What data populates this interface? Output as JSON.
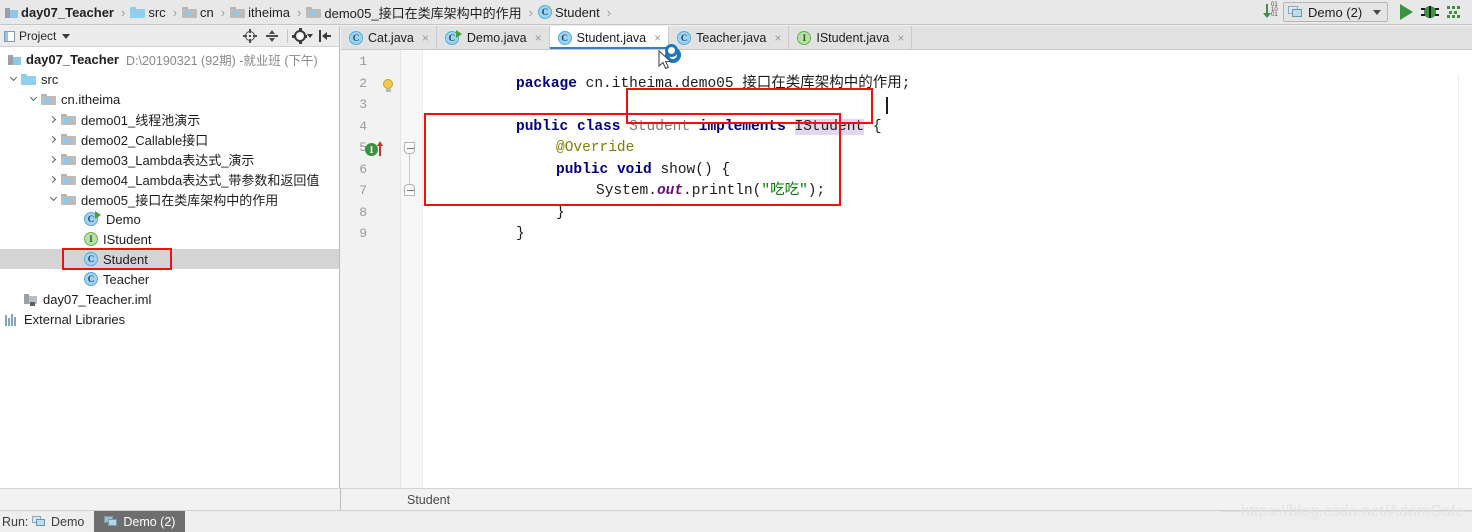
{
  "window": {
    "ide": "IntelliJ IDEA",
    "watermark": "https://blog.csdn.net/AdamCafe"
  },
  "navbar": {
    "crumbs": [
      {
        "label": "day07_Teacher",
        "icon": "module-icon",
        "bold": true
      },
      {
        "label": "src",
        "icon": "source-folder-icon",
        "bold": false
      },
      {
        "label": "cn",
        "icon": "package-icon",
        "bold": false
      },
      {
        "label": "itheima",
        "icon": "package-icon",
        "bold": false
      },
      {
        "label": "demo05_接口在类库架构中的作用",
        "icon": "package-icon",
        "bold": false
      },
      {
        "label": "Student",
        "icon": "class-icon",
        "bold": false
      }
    ],
    "separator": "›",
    "sort_icon": "sort-numeric-icon",
    "sort_digits": [
      "01",
      "10",
      "01"
    ],
    "run_config": {
      "name": "Demo (2)",
      "icon": "run-configuration-icon",
      "chevron": "chevron-down-icon"
    },
    "run_button": "run-icon",
    "debug_button": "debug-icon",
    "coverage_button": "coverage-icon"
  },
  "project_panel": {
    "title": "Project",
    "actions": [
      "locate-icon",
      "collapse-all-icon",
      "settings-gear-icon",
      "hide-icon"
    ],
    "tree": [
      {
        "id": "root",
        "label": "day07_Teacher",
        "path": "D:\\20190321 (92期) -就业班 (下午)",
        "icon": "module-icon",
        "indent": 0,
        "arrow": "none",
        "bold": true,
        "selected": false
      },
      {
        "id": "src",
        "label": "src",
        "path": "",
        "icon": "source-folder-icon",
        "indent": 1,
        "arrow": "down",
        "bold": false,
        "selected": false
      },
      {
        "id": "cn-itheima",
        "label": "cn.itheima",
        "path": "",
        "icon": "package-icon",
        "indent": 2,
        "arrow": "down",
        "bold": false,
        "selected": false
      },
      {
        "id": "demo01",
        "label": "demo01_线程池演示",
        "path": "",
        "icon": "package-icon",
        "indent": 3,
        "arrow": "right",
        "bold": false,
        "selected": false
      },
      {
        "id": "demo02",
        "label": "demo02_Callable接口",
        "path": "",
        "icon": "package-icon",
        "indent": 3,
        "arrow": "right",
        "bold": false,
        "selected": false
      },
      {
        "id": "demo03",
        "label": "demo03_Lambda表达式_演示",
        "path": "",
        "icon": "package-icon",
        "indent": 3,
        "arrow": "right",
        "bold": false,
        "selected": false
      },
      {
        "id": "demo04",
        "label": "demo04_Lambda表达式_带参数和返回值",
        "path": "",
        "icon": "package-icon",
        "indent": 3,
        "arrow": "right",
        "bold": false,
        "selected": false
      },
      {
        "id": "demo05",
        "label": "demo05_接口在类库架构中的作用",
        "path": "",
        "icon": "package-icon",
        "indent": 3,
        "arrow": "down",
        "bold": false,
        "selected": false
      },
      {
        "id": "demo-class",
        "label": "Demo",
        "path": "",
        "icon": "runnable-class-icon",
        "indent": 4,
        "arrow": "none",
        "bold": false,
        "selected": false
      },
      {
        "id": "istudent",
        "label": "IStudent",
        "path": "",
        "icon": "interface-icon",
        "indent": 4,
        "arrow": "none",
        "bold": false,
        "selected": false
      },
      {
        "id": "student",
        "label": "Student",
        "path": "",
        "icon": "class-icon",
        "indent": 4,
        "arrow": "none",
        "bold": false,
        "selected": true
      },
      {
        "id": "teacher",
        "label": "Teacher",
        "path": "",
        "icon": "class-icon",
        "indent": 4,
        "arrow": "none",
        "bold": false,
        "selected": false
      },
      {
        "id": "iml",
        "label": "day07_Teacher.iml",
        "path": "",
        "icon": "iml-file-icon",
        "indent": 1,
        "arrow": "none",
        "bold": false,
        "selected": false
      },
      {
        "id": "extlibs",
        "label": "External Libraries",
        "path": "",
        "icon": "external-libraries-icon",
        "indent": 0,
        "arrow": "none",
        "bold": false,
        "selected": false
      }
    ]
  },
  "editor": {
    "tabs": [
      {
        "label": "Cat.java",
        "icon": "class-icon",
        "active": false
      },
      {
        "label": "Demo.java",
        "icon": "runnable-class-icon",
        "active": false
      },
      {
        "label": "Student.java",
        "icon": "class-icon",
        "active": true
      },
      {
        "label": "Teacher.java",
        "icon": "class-icon",
        "active": false
      },
      {
        "label": "IStudent.java",
        "icon": "interface-icon",
        "active": false
      }
    ],
    "close_glyph": "close-icon",
    "line_numbers": [
      "1",
      "2",
      "3",
      "4",
      "5",
      "6",
      "7",
      "8",
      "9"
    ],
    "gutter": {
      "intention_bulb_line": 2,
      "implementing_method_line": 5,
      "implementing_method_letter": "I"
    },
    "code": {
      "line1": {
        "kw": "package",
        "rest": " cn.itheima.demo05_接口在类库架构中的作用;"
      },
      "line3": {
        "kw1": "public",
        "kw2": "class",
        "name": "Student",
        "kw3": "implements",
        "iface": "IStudent",
        "brace": "{"
      },
      "line4": {
        "annotation": "@Override"
      },
      "line5": {
        "kw1": "public",
        "kw2": "void",
        "sig": "show() {"
      },
      "line6": {
        "obj": "System.",
        "field": "out",
        "call": ".println(",
        "q1": "\"",
        "str": "吃吃",
        "q2": "\"",
        "tail": ");"
      },
      "line7": {
        "brace": "}"
      },
      "line8": {
        "brace": "}"
      }
    },
    "highlighted_identifier": "IStudent",
    "bottom_breadcrumb": "Student"
  },
  "annotations": [
    {
      "name": "implements-clause-highlight",
      "note": "red rectangle around implements IStudent {"
    },
    {
      "name": "method-body-highlight",
      "note": "red rectangle around @Override show() method"
    },
    {
      "name": "student-tree-node-highlight",
      "note": "red rectangle around Student in project tree"
    }
  ],
  "statusbar": {
    "run_label": "Run:",
    "tabs": [
      {
        "label": "Demo",
        "selected": false,
        "icon": "run-configuration-icon"
      },
      {
        "label": "Demo (2)",
        "selected": true,
        "icon": "run-configuration-icon"
      }
    ]
  }
}
